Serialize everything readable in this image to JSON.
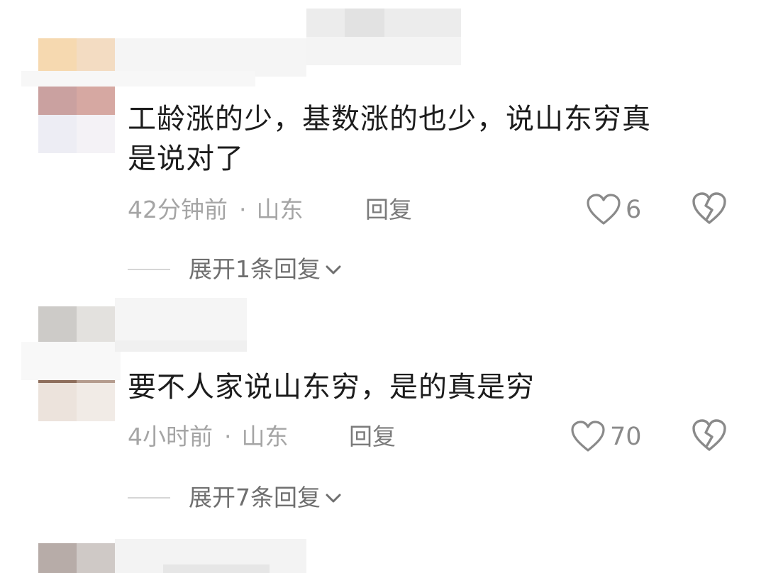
{
  "comments": [
    {
      "text": "工龄涨的少，基数涨的也少，说山东穷真\n是说对了",
      "time": "42分钟前",
      "separator": "·",
      "location": "山东",
      "reply_label": "回复",
      "like_count": "6",
      "expand_label": "展开1条回复"
    },
    {
      "text": "要不人家说山东穷，是的真是穷",
      "time": "4小时前",
      "separator": "·",
      "location": "山东",
      "reply_label": "回复",
      "like_count": "70",
      "expand_label": "展开7条回复"
    }
  ],
  "icons": {
    "like": "heart-outline-icon",
    "dislike": "broken-heart-icon",
    "expand": "chevron-down-icon"
  },
  "colors": {
    "text": "#1c1c1c",
    "meta": "#a5a5a5",
    "icon": "#8a8a8a"
  }
}
